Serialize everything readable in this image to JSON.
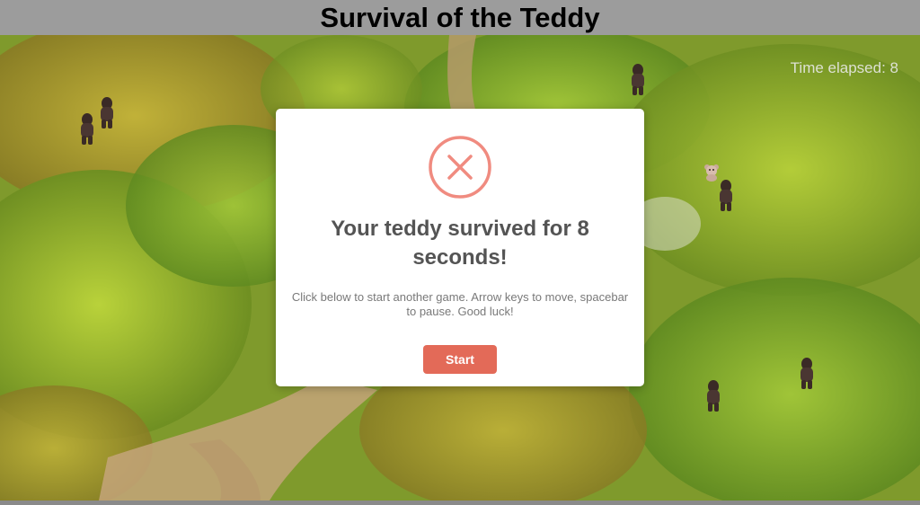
{
  "header": {
    "title": "Survival of the Teddy"
  },
  "hud": {
    "timer_text": "Time elapsed: 8"
  },
  "modal": {
    "icon": "error-x-icon",
    "heading": "Your teddy survived for 8 seconds!",
    "body": "Click below to start another game. Arrow keys to move, spacebar to pause. Good luck!",
    "start_label": "Start"
  },
  "colors": {
    "accent": "#e36a58",
    "icon_ring": "#f08b80",
    "heading_text": "#545454",
    "body_text": "#797979"
  }
}
